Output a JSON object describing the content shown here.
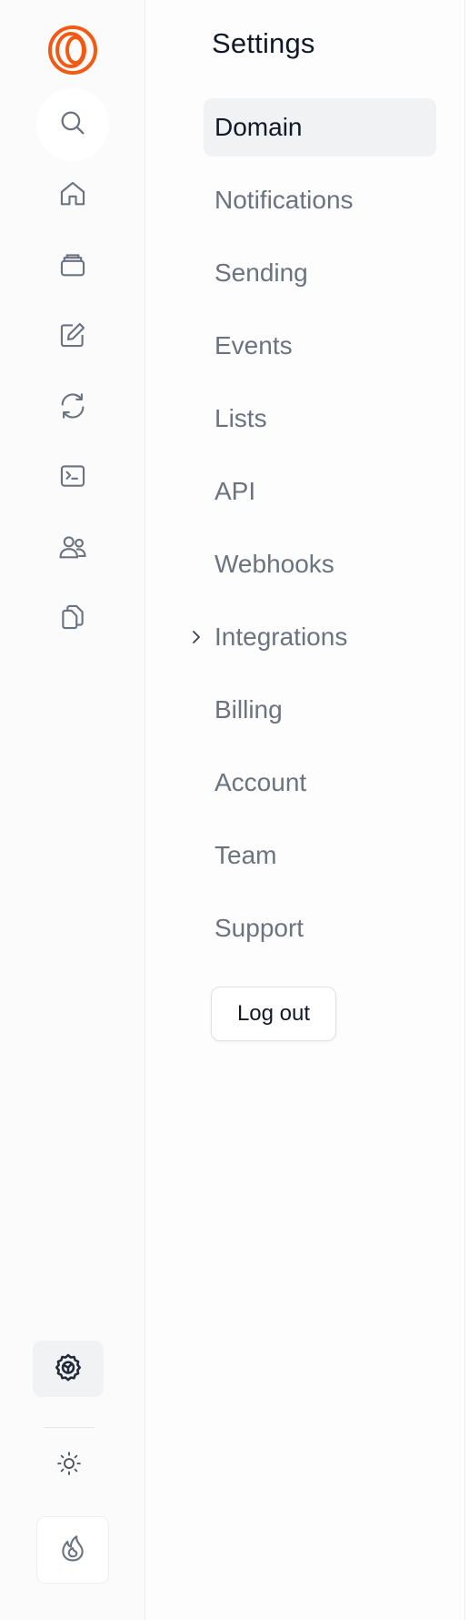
{
  "brand": {
    "logo_icon": "concentric-rings-logo",
    "accent_color": "#f25a14"
  },
  "rail": {
    "items": [
      {
        "name": "search",
        "icon": "search-icon"
      },
      {
        "name": "home",
        "icon": "home-icon"
      },
      {
        "name": "inbox",
        "icon": "inbox-icon"
      },
      {
        "name": "compose",
        "icon": "edit-icon"
      },
      {
        "name": "automations",
        "icon": "refresh-icon"
      },
      {
        "name": "terminal",
        "icon": "terminal-icon"
      },
      {
        "name": "contacts",
        "icon": "users-icon"
      },
      {
        "name": "templates",
        "icon": "copy-icon"
      }
    ],
    "bottom": [
      {
        "name": "settings",
        "icon": "gear-icon",
        "active": true
      },
      {
        "name": "theme",
        "icon": "sun-icon"
      },
      {
        "name": "user",
        "icon": "flame-icon"
      }
    ]
  },
  "settings": {
    "title": "Settings",
    "items": [
      {
        "label": "Domain",
        "active": true
      },
      {
        "label": "Notifications"
      },
      {
        "label": "Sending"
      },
      {
        "label": "Events"
      },
      {
        "label": "Lists"
      },
      {
        "label": "API"
      },
      {
        "label": "Webhooks"
      },
      {
        "label": "Integrations",
        "expandable": true
      },
      {
        "label": "Billing"
      },
      {
        "label": "Account"
      },
      {
        "label": "Team"
      },
      {
        "label": "Support"
      }
    ],
    "logout_label": "Log out"
  }
}
